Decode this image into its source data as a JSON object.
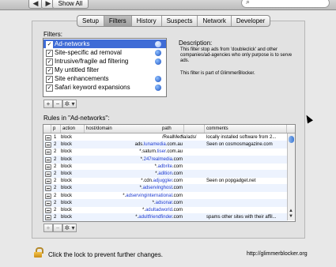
{
  "toolbar": {
    "back_label": "◀",
    "forward_label": "▶",
    "show_all_label": "Show All",
    "search_placeholder": ""
  },
  "tabs": [
    {
      "label": "Setup",
      "active": false
    },
    {
      "label": "Filters",
      "active": true
    },
    {
      "label": "History",
      "active": false
    },
    {
      "label": "Suspects",
      "active": false
    },
    {
      "label": "Network",
      "active": false
    },
    {
      "label": "Developer",
      "active": false
    }
  ],
  "filters": {
    "label": "Filters:",
    "items": [
      {
        "label": "Ad-networks",
        "checked": true,
        "selected": true,
        "subscribed": true
      },
      {
        "label": "Site-specific ad removal",
        "checked": true,
        "selected": false,
        "subscribed": true
      },
      {
        "label": "Intrusive/fragile ad filtering",
        "checked": true,
        "selected": false,
        "subscribed": true
      },
      {
        "label": "My untitled filter",
        "checked": true,
        "selected": false,
        "subscribed": false
      },
      {
        "label": "Site enhancements",
        "checked": true,
        "selected": false,
        "subscribed": true
      },
      {
        "label": "Safari keyword expansions",
        "checked": true,
        "selected": false,
        "subscribed": true
      }
    ],
    "add_label": "+",
    "remove_label": "−",
    "action_label": "✲ ▾"
  },
  "description": {
    "title": "Description:",
    "body": "This filter stop ads from 'doubleclick' and other companies/ad-agencies who only purpose is to serve ads.",
    "note": "This filter is part of GlimmerBlocker."
  },
  "rules": {
    "label": "Rules in \"Ad-networks\":",
    "columns": [
      "p",
      "action",
      "host/domain",
      "path",
      "comments"
    ],
    "rows": [
      {
        "p": "1",
        "action": "block",
        "host_pre": "*",
        "host_hl": "",
        "host_post": "",
        "path": "/RealMedia/ads/",
        "comment": "locally installed software from 2..."
      },
      {
        "p": "2",
        "action": "block",
        "host_pre": "ads.",
        "host_hl": "lunamedia",
        "host_post": ".com.au",
        "path": "",
        "comment": "Seen on cosmosmagazine.com"
      },
      {
        "p": "2",
        "action": "block",
        "host_pre": "*.saturn.",
        "host_hl": "tiser",
        "host_post": ".com.au",
        "path": "",
        "comment": ""
      },
      {
        "p": "2",
        "action": "block",
        "host_pre": "*.",
        "host_hl": "247realmedia",
        "host_post": ".com",
        "path": "",
        "comment": ""
      },
      {
        "p": "2",
        "action": "block",
        "host_pre": "*.",
        "host_hl": "adbrite",
        "host_post": ".com",
        "path": "",
        "comment": ""
      },
      {
        "p": "2",
        "action": "block",
        "host_pre": "*.",
        "host_hl": "adition",
        "host_post": ".com",
        "path": "",
        "comment": ""
      },
      {
        "p": "2",
        "action": "block",
        "host_pre": "*.cdn.",
        "host_hl": "adjuggler",
        "host_post": ".com",
        "path": "",
        "comment": "Seen on popgadget.net"
      },
      {
        "p": "2",
        "action": "block",
        "host_pre": "*.",
        "host_hl": "adservinghost",
        "host_post": ".com",
        "path": "",
        "comment": ""
      },
      {
        "p": "2",
        "action": "block",
        "host_pre": "*.",
        "host_hl": "adservinginternational",
        "host_post": ".com",
        "path": "",
        "comment": ""
      },
      {
        "p": "2",
        "action": "block",
        "host_pre": "*.",
        "host_hl": "adsonar",
        "host_post": ".com",
        "path": "",
        "comment": ""
      },
      {
        "p": "2",
        "action": "block",
        "host_pre": "*.",
        "host_hl": "adultadworld",
        "host_post": ".com",
        "path": "",
        "comment": ""
      },
      {
        "p": "2",
        "action": "block",
        "host_pre": "*.",
        "host_hl": "adultfriendfinder",
        "host_post": ".com",
        "path": "",
        "comment": "spams other sites with their affil..."
      }
    ]
  },
  "footer": {
    "lock_text": "Click the lock to prevent further changes.",
    "url": "http://glimmerblocker.org"
  },
  "colors": {
    "selection": "#3f6cd6",
    "link_host": "#1d3bd1"
  }
}
